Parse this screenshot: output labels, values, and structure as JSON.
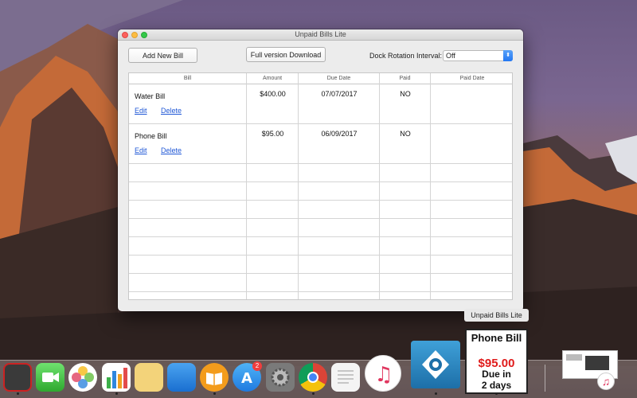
{
  "window": {
    "title": "Unpaid Bills Lite",
    "add_button": "Add New Bill",
    "download_button": "Full version Download",
    "dock_rotation_label": "Dock Rotation Interval:",
    "dock_rotation_value": "Off"
  },
  "table": {
    "headers": [
      "Bill",
      "Amount",
      "Due Date",
      "Paid",
      "Paid Date"
    ],
    "rows": [
      {
        "bill": "Water Bill",
        "amount": "$400.00",
        "due": "07/07/2017",
        "paid": "NO",
        "paid_date": "",
        "edit": "Edit",
        "delete": "Delete"
      },
      {
        "bill": "Phone Bill",
        "amount": "$95.00",
        "due": "06/09/2017",
        "paid": "NO",
        "paid_date": "",
        "edit": "Edit",
        "delete": "Delete"
      }
    ]
  },
  "dock": {
    "tooltip": "Unpaid Bills Lite",
    "app_store_badge": "2",
    "tile": {
      "name": "Phone Bill",
      "amount": "$95.00",
      "due_line1": "Due in",
      "due_line2": "2 days"
    },
    "icons": [
      "photo-booth-icon",
      "facetime-icon",
      "photos-icon",
      "numbers-icon",
      "pages-icon",
      "keynote-icon",
      "ibooks-icon",
      "app-store-icon",
      "system-preferences-icon",
      "chrome-icon",
      "textedit-icon",
      "itunes-icon",
      "screen-capture-icon",
      "unpaid-bills-tile",
      "preview-window-thumb"
    ]
  },
  "colors": {
    "link": "#1f57d6",
    "amount_red": "#e01b1b",
    "select_accent": "#2377f2"
  }
}
